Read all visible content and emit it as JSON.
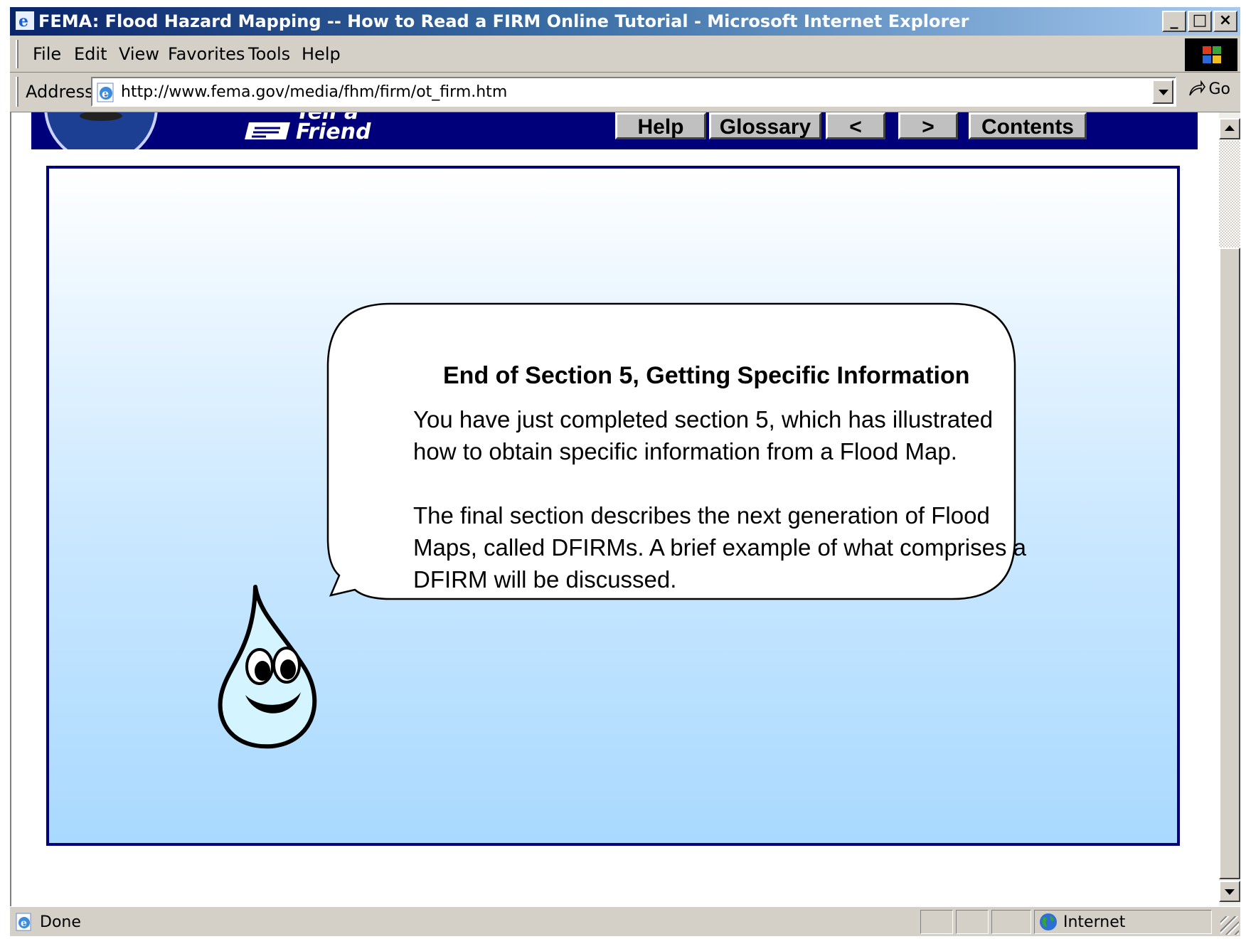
{
  "window": {
    "title": "FEMA: Flood Hazard Mapping -- How to Read a FIRM Online Tutorial - Microsoft Internet Explorer",
    "minimize": "_",
    "maximize": "□",
    "close": "×"
  },
  "menu": {
    "items": [
      "File",
      "Edit",
      "View",
      "Favorites",
      "Tools",
      "Help"
    ]
  },
  "address": {
    "label": "Address",
    "url": "http://www.fema.gov/media/fhm/firm/ot_firm.htm",
    "go_label": "Go"
  },
  "banner": {
    "tell_line1": "Tell a",
    "tell_line2": "Friend",
    "buttons": [
      "Help",
      "Glossary",
      "<",
      ">",
      "Contents"
    ]
  },
  "bubble": {
    "title": "End of Section 5, Getting Specific Information",
    "para1": "You have just completed section 5, which has illustrated how to obtain specific information from a Flood Map.",
    "para2": "The final section describes the next generation of Flood Maps, called DFIRMs. A brief example of what comprises a DFIRM will be discussed."
  },
  "status": {
    "text": "Done",
    "zone": "Internet"
  },
  "icons": {
    "app": "ie-icon",
    "address": "ie-page-icon",
    "go": "go-arrow-icon",
    "status": "ie-page-icon",
    "zone": "globe-icon",
    "mascot": "water-drop-mascot"
  },
  "colors": {
    "title_bar": "#0a246a",
    "banner": "#00007b",
    "frame_border": "#00007b",
    "frame_gradient_bottom": "#a9d9ff",
    "chrome": "#d4d0c8"
  }
}
